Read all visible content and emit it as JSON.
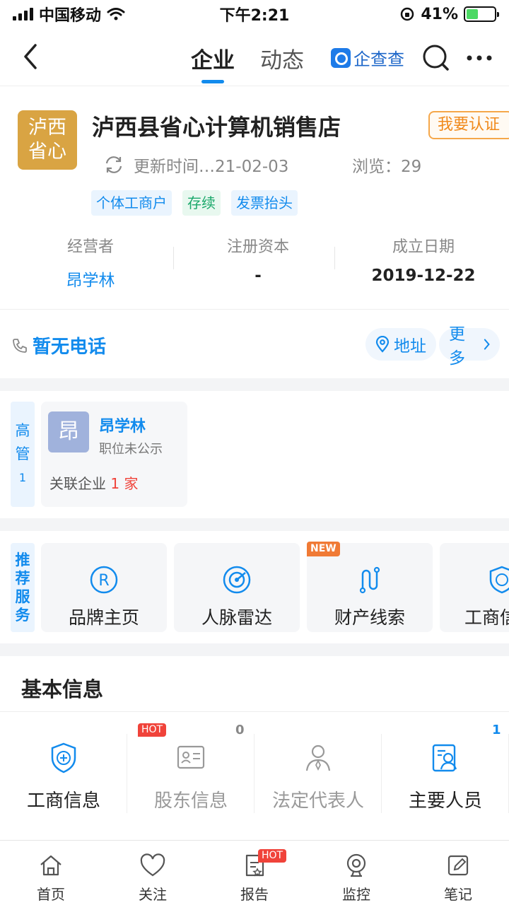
{
  "status_bar": {
    "carrier": "中国移动",
    "time": "下午2:21",
    "battery": "41%",
    "battery_level": 0.41
  },
  "nav": {
    "tabs": [
      "企业",
      "动态"
    ],
    "active_tab": 0,
    "brand": "企查查"
  },
  "company": {
    "logo_text_line1": "泸西",
    "logo_text_line2": "省心",
    "name": "泸西县省心计算机销售店",
    "verify_label": "我要认证",
    "update_text": "更新时间…21-02-03",
    "views_text": "浏览：29",
    "tags": [
      "个体工商户",
      "存续",
      "发票抬头"
    ],
    "stats": [
      {
        "label": "经营者",
        "value": "昂学林"
      },
      {
        "label": "注册资本",
        "value": "-"
      },
      {
        "label": "成立日期",
        "value": "2019-12-22"
      }
    ]
  },
  "contact": {
    "phone": "暂无电话",
    "address": "地址",
    "more": "更多"
  },
  "executives": {
    "side_label_1": "高",
    "side_label_2": "管",
    "count": "1",
    "person": {
      "avatar": "昂",
      "name": "昂学林",
      "position": "职位未公示",
      "related_prefix": "关联企业",
      "related_count": "1 家"
    }
  },
  "services": {
    "side_label": [
      "推",
      "荐",
      "服",
      "务"
    ],
    "new_badge": "NEW",
    "items": [
      "品牌主页",
      "人脉雷达",
      "财产线索",
      "工商信息"
    ]
  },
  "basic_info": {
    "title": "基本信息",
    "hot_badge": "HOT",
    "items": [
      {
        "label": "工商信息"
      },
      {
        "label": "股东信息",
        "count": "0"
      },
      {
        "label": "法定代表人"
      },
      {
        "label": "主要人员",
        "count": "1"
      }
    ]
  },
  "tabbar": {
    "hot_badge": "HOT",
    "items": [
      "首页",
      "关注",
      "报告",
      "监控",
      "笔记"
    ]
  },
  "colors": {
    "accent": "#128bed",
    "logo_bg": "#d9a443",
    "hot": "#f0433a",
    "new": "#f07a35"
  }
}
